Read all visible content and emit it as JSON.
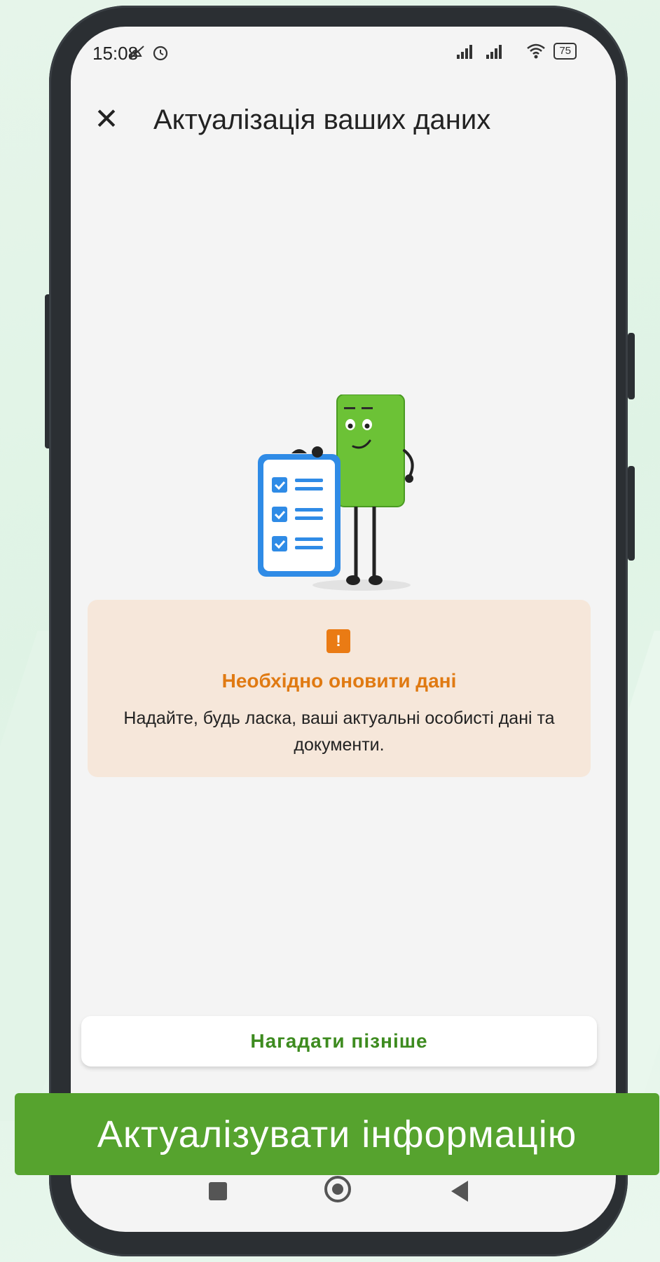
{
  "status_bar": {
    "time": "15:08",
    "icons_left": "⨯ ⏰",
    "signal": ".ııl .ııl",
    "wifi": "wifi-icon",
    "battery": "75"
  },
  "app_bar": {
    "close_icon": "close-icon",
    "title": "Актуалізація ваших даних"
  },
  "notice": {
    "icon": "!",
    "title": "Необхідно оновити дані",
    "text": "Надайте, будь ласка, ваші актуальні особисті дані та документи."
  },
  "buttons": {
    "remind_later": "Нагадати пізніше",
    "update_info": "Актуалізувати інформацію"
  },
  "colors": {
    "accent_green": "#56a32e",
    "text_green": "#3d8b1f",
    "warning_orange": "#e07a12",
    "notice_bg": "#f6e7da"
  }
}
